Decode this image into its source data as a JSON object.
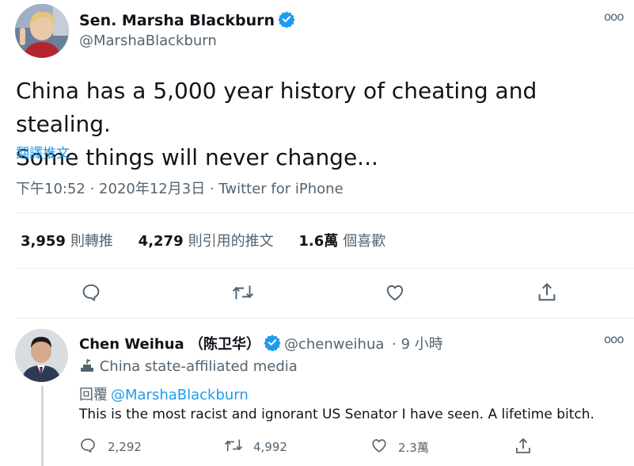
{
  "main_tweet": {
    "display_name": "Sen. Marsha Blackburn",
    "handle": "@MarshaBlackburn",
    "text_line1": "China has a 5,000 year history of cheating and stealing.",
    "text_line2": "Some things will never change...",
    "translate_label": "翻譯推文",
    "timestamp": "下午10:52 · 2020年12月3日 · ",
    "source": "Twitter for iPhone",
    "stats": {
      "retweets_count": "3,959",
      "retweets_label": "則轉推",
      "quotes_count": "4,279",
      "quotes_label": "則引用的推文",
      "likes_count": "1.6萬",
      "likes_label": "個喜歡"
    }
  },
  "reply_tweet": {
    "display_name": "Chen Weihua （陈卫华）",
    "handle": "@chenweihua",
    "time": "· 9 小時",
    "state_label": "China state-affiliated media",
    "replying_label": "回覆",
    "replying_to": "@MarshaBlackburn",
    "text": "This is the most racist and ignorant US Senator I have seen.  A lifetime bitch.",
    "reply_count": "2,292",
    "retweet_count": "4,992",
    "like_count": "2.3萬"
  },
  "more_glyph": "ooo",
  "colors": {
    "accent": "#1d9bf0",
    "text": "#0f1419",
    "muted": "#536471",
    "divider": "#e6ecf0"
  },
  "icons": [
    "verified-badge-icon",
    "reply-icon",
    "retweet-icon",
    "like-icon",
    "share-icon",
    "state-media-icon",
    "more-icon"
  ]
}
